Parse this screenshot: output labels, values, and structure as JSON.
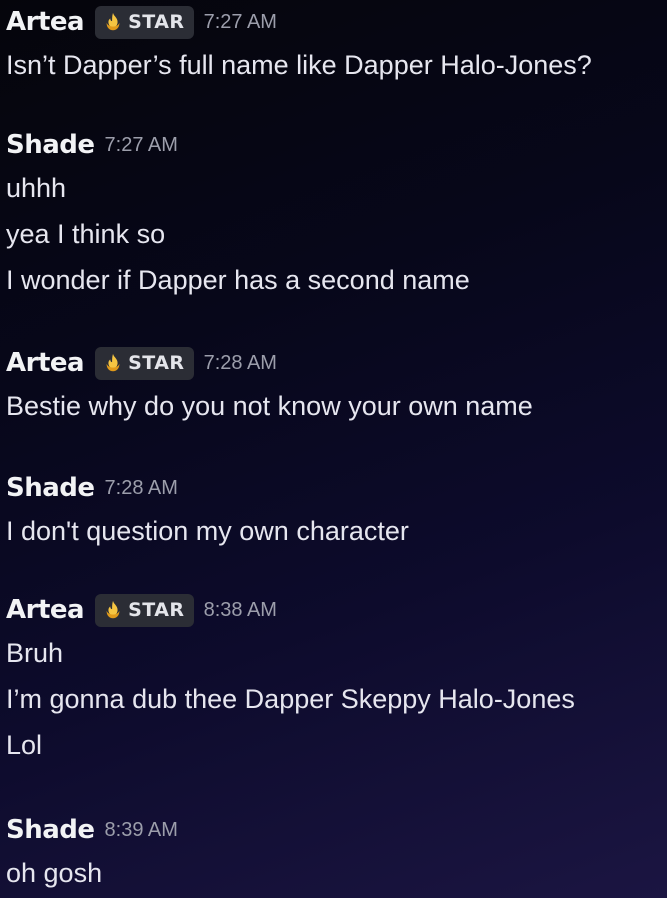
{
  "messages": [
    {
      "author": "Artea",
      "tag": {
        "label": "STAR",
        "icon": "star-fire-icon",
        "color": "#f0b232"
      },
      "time": "7:27 AM",
      "lines": [
        "Isn’t Dapper’s full name like Dapper Halo-Jones?"
      ]
    },
    {
      "author": "Shade",
      "time": "7:27 AM",
      "lines": [
        "uhhh",
        "yea I think so",
        "I wonder if Dapper has a second name"
      ]
    },
    {
      "author": "Artea",
      "tag": {
        "label": "STAR",
        "icon": "star-fire-icon",
        "color": "#f0b232"
      },
      "time": "7:28 AM",
      "lines": [
        "Bestie why do you not know your own name"
      ]
    },
    {
      "author": "Shade",
      "time": "7:28 AM",
      "lines": [
        "I don't question my own character"
      ]
    },
    {
      "author": "Artea",
      "tag": {
        "label": "STAR",
        "icon": "star-fire-icon",
        "color": "#f0b232"
      },
      "time": "8:38 AM",
      "lines": [
        "Bruh",
        "I’m gonna dub thee Dapper Skeppy Halo-Jones",
        "Lol"
      ]
    },
    {
      "author": "Shade",
      "time": "8:39 AM",
      "lines": [
        "oh gosh"
      ]
    }
  ]
}
